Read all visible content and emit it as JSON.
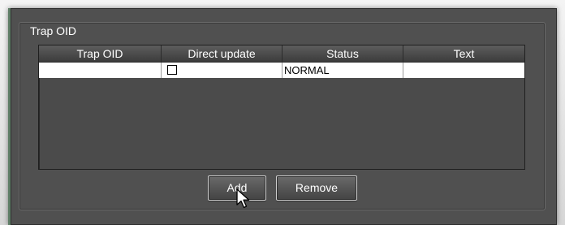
{
  "group": {
    "title": "Trap OID"
  },
  "table": {
    "columns": [
      "Trap OID",
      "Direct update",
      "Status",
      "Text"
    ],
    "rows": [
      {
        "trap_oid": "",
        "direct_update": false,
        "status": "NORMAL",
        "text": ""
      }
    ]
  },
  "buttons": {
    "add_label": "Add",
    "remove_label": "Remove"
  },
  "icons": {
    "cursor": "pointer-arrow-icon",
    "checkbox": "checkbox-unchecked-icon"
  },
  "colors": {
    "panel": "#505050",
    "header": "#4a4a4a",
    "accent_border": "#5e7d66"
  }
}
